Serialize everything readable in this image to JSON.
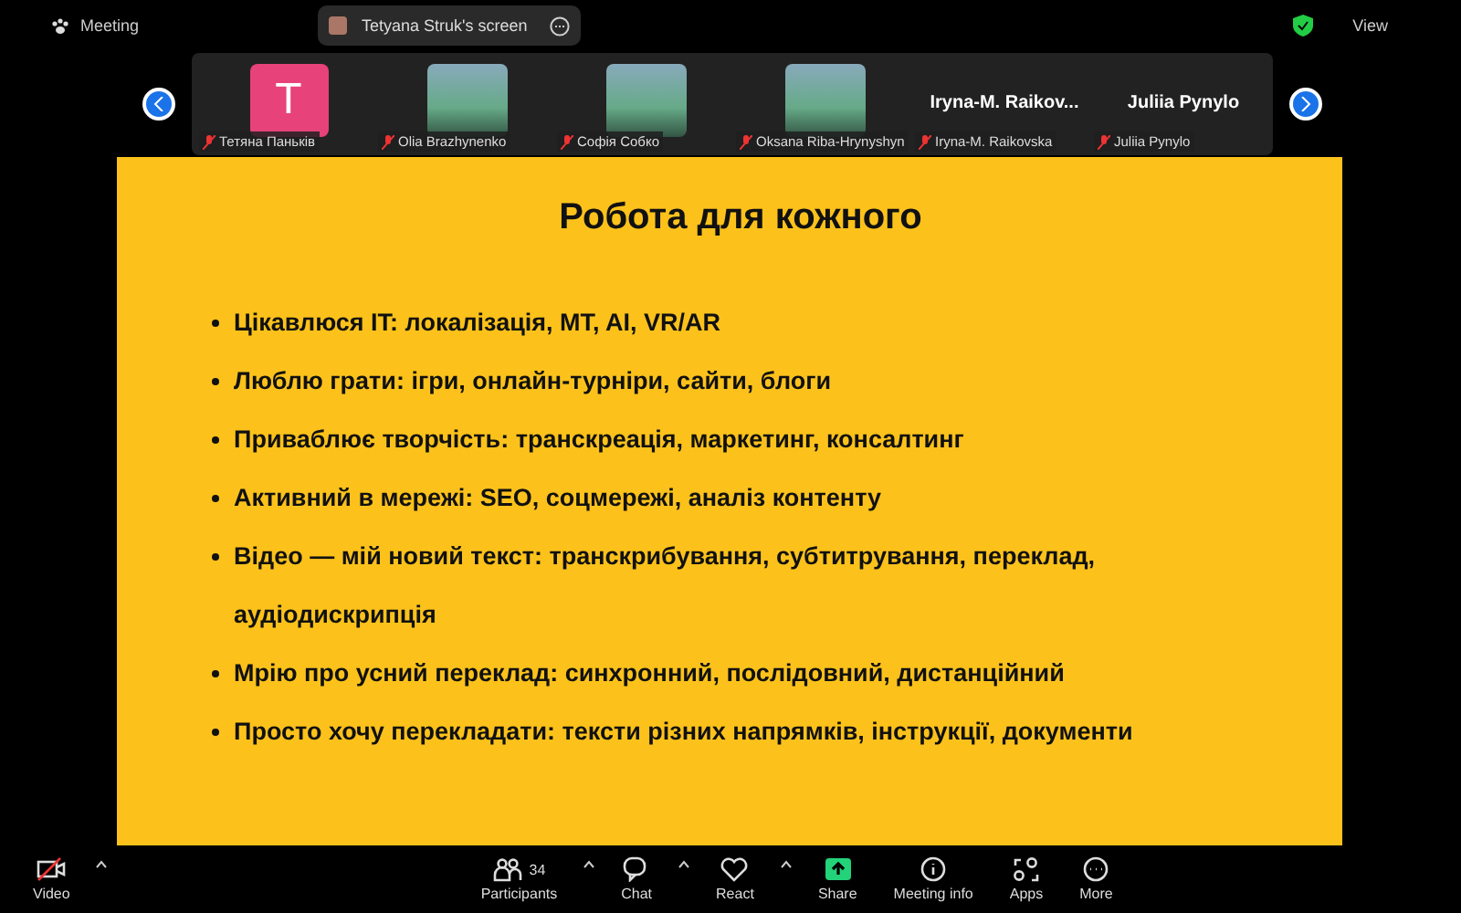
{
  "top_bar": {
    "meeting_label": "Meeting",
    "share_banner": "Tetyana Struk's screen",
    "view_label": "View"
  },
  "gallery": [
    {
      "kind": "letter",
      "letter": "T",
      "name": "Тетяна Паньків",
      "muted": true
    },
    {
      "kind": "photo",
      "name": "Olia Brazhynenko",
      "muted": true
    },
    {
      "kind": "photo",
      "name": "Софія Собко",
      "muted": true
    },
    {
      "kind": "photo",
      "name": "Oksana Riba-Hrynyshyn",
      "muted": true
    },
    {
      "kind": "text",
      "display": "Iryna-M.  Raikov...",
      "name": "Iryna-M. Raikovska",
      "muted": true
    },
    {
      "kind": "text",
      "display": "Juliia Pynylo",
      "name": "Juliia Pynylo",
      "muted": true
    }
  ],
  "slide": {
    "title": "Робота для кожного",
    "bullets": [
      "Цікавлюся IT: локалізація, MT, AI, VR/AR",
      "Люблю грати: ігри, онлайн-турніри, сайти, блоги",
      "Приваблює творчість: транскреація, маркетинг, консалтинг",
      "Активний в мережі: SEO, соцмережі, аналіз контенту",
      "Відео — мій новий текст: транскрибування, субтитрування, переклад, аудіодискрипція",
      "Мрію про усний переклад: синхронний, послідовний, дистанційний",
      "Просто хочу перекладати: тексти різних напрямків, інструкції, документи"
    ]
  },
  "toolbar": {
    "left": [
      {
        "kind": "video",
        "label": "Video",
        "caret": true
      }
    ],
    "center": [
      {
        "kind": "participants",
        "label": "Participants",
        "count": "34",
        "caret": true
      },
      {
        "kind": "chat",
        "label": "Chat",
        "caret": true
      },
      {
        "kind": "react",
        "label": "React",
        "caret": true
      },
      {
        "kind": "share",
        "label": "Share",
        "caret": false
      },
      {
        "kind": "info",
        "label": "Meeting info",
        "caret": false
      },
      {
        "kind": "apps",
        "label": "Apps",
        "caret": false
      },
      {
        "kind": "more",
        "label": "More",
        "caret": false
      }
    ]
  }
}
